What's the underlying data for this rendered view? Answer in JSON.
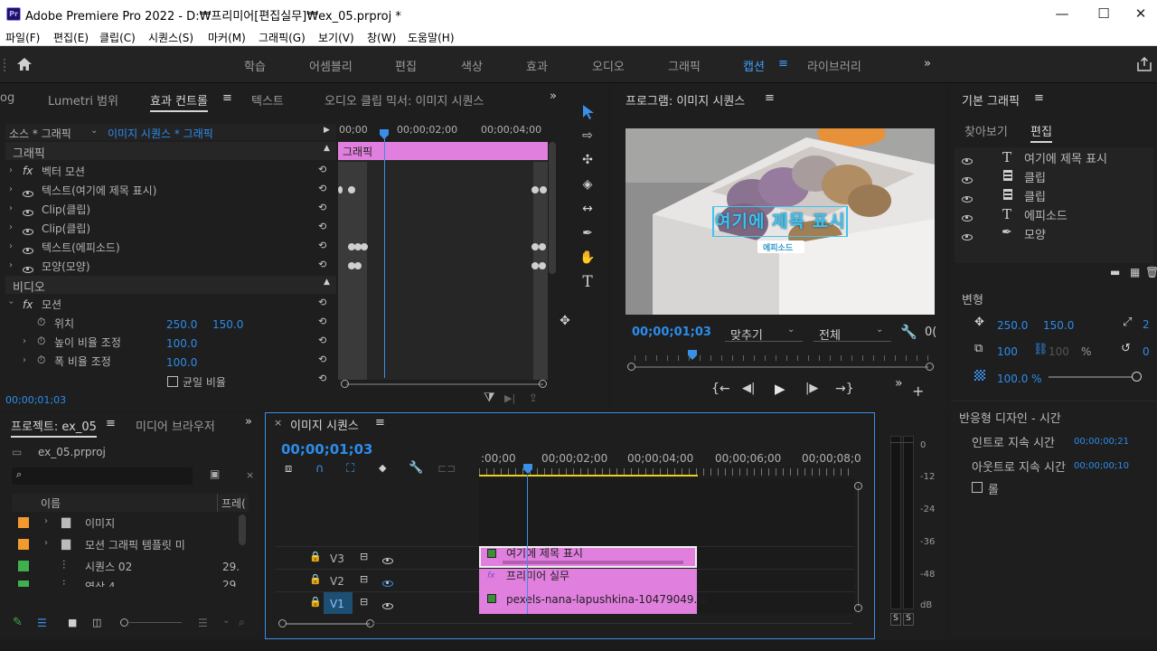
{
  "app": {
    "title": "Adobe Premiere Pro 2022 - D:₩프리미어[편집실무]₩ex_05.prproj *",
    "logo": "Pr",
    "window_controls": [
      "—",
      "☐",
      "✕"
    ]
  },
  "menu": [
    "파일(F)",
    "편집(E)",
    "클립(C)",
    "시퀀스(S)",
    "마커(M)",
    "그래픽(G)",
    "보기(V)",
    "창(W)",
    "도움말(H)"
  ],
  "workspaces": {
    "items": [
      "학습",
      "어셈블리",
      "편집",
      "색상",
      "효과",
      "오디오",
      "그래픽",
      "캡션",
      "라이브러리"
    ],
    "active": "캡션",
    "menu_glyph": "≡",
    "overflow": "»"
  },
  "effect_controls": {
    "tabs": [
      "og",
      "Lumetri 범위",
      "효과 컨트롤",
      "텍스트",
      "오디오 클립 믹서: 이미지 시퀀스"
    ],
    "active_tab": "효과 컨트롤",
    "source_label": "소스 * 그래픽",
    "sequence_label": "이미지 시퀀스 * 그래픽",
    "ruler": [
      "00;00",
      "00;00;02;00",
      "00;00;04;00"
    ],
    "clip_bar_label": "그래픽",
    "section_graphic": "그래픽",
    "section_video": "비디오",
    "graphic_rows": [
      {
        "label": "벡터 모션",
        "fx": true
      },
      {
        "label": "텍스트(여기에 제목 표시)"
      },
      {
        "label": "Clip(클립)"
      },
      {
        "label": "Clip(클립)"
      },
      {
        "label": "텍스트(에피소드)"
      },
      {
        "label": "모양(모양)"
      }
    ],
    "motion_label": "모션",
    "position": {
      "label": "위치",
      "x": "250.0",
      "y": "150.0"
    },
    "scale_h": {
      "label": "높이 비율 조정",
      "value": "100.0"
    },
    "scale_w": {
      "label": "폭 비율 조정",
      "value": "100.0"
    },
    "uniform": "균일 비율",
    "timecode": "00;00;01;03"
  },
  "tools": [
    "selection-tool",
    "track-select-tool",
    "ripple-edit-tool",
    "razor-tool",
    "slip-tool",
    "pen-tool",
    "hand-tool",
    "type-tool"
  ],
  "program": {
    "title": "프로그램: 이미지 시퀀스",
    "overlay_title": "여기에 제목 표시",
    "overlay_badge": "에피소드",
    "timecode": "00;00;01;03",
    "fit": "맞추기",
    "quality": "전체",
    "right_tc": "0("
  },
  "essential_graphics": {
    "title": "기본 그래픽",
    "tabs": [
      "찾아보기",
      "편집"
    ],
    "active_tab": "편집",
    "layers": [
      {
        "icon": "T",
        "label": "여기에 제목 표시"
      },
      {
        "icon": "clip",
        "label": "클립"
      },
      {
        "icon": "clip",
        "label": "클립"
      },
      {
        "icon": "T",
        "label": "에피소드"
      },
      {
        "icon": "pen",
        "label": "모양"
      }
    ],
    "transform_label": "변형",
    "pos_x": "250.0",
    "pos_y": "150.0",
    "anchor": "2",
    "scale": "100",
    "scale2": "100",
    "percent": "%",
    "rotation": "0",
    "opacity": "100.0 %",
    "responsive_title": "반응형 디자인 - 시간",
    "intro_label": "인트로 지속 시간",
    "intro_value": "00;00;00;21",
    "outro_label": "아웃트로 지속 시간",
    "outro_value": "00;00;00;10",
    "roll_label": "롤"
  },
  "project": {
    "tabs": [
      "프로젝트: ex_05",
      "미디어 브라우저"
    ],
    "file": "ex_05.prproj",
    "col_name": "이름",
    "col_frame": "프레(",
    "items": [
      {
        "color": "#f29a2e",
        "type": "folder",
        "label": "이미지",
        "value": ""
      },
      {
        "color": "#f29a2e",
        "type": "folder",
        "label": "모션 그래픽 템플릿 미",
        "value": ""
      },
      {
        "color": "#3fb04c",
        "type": "sequence",
        "label": "시퀀스 02",
        "value": "29."
      },
      {
        "color": "#3fb04c",
        "type": "sequence",
        "label": "영상 4",
        "value": "29."
      }
    ]
  },
  "timeline": {
    "title": "이미지 시퀀스",
    "timecode": "00;00;01;03",
    "ruler": [
      ":00;00",
      "00;00;02;00",
      "00;00;04;00",
      "00;00;06;00",
      "00;00;08;0"
    ],
    "tracks": [
      {
        "name": "V3",
        "clip": "여기에 제목 표시"
      },
      {
        "name": "V2",
        "clip": "프리미어 실무"
      },
      {
        "name": "V1",
        "clip": "pexels-nana-lapushkina-10479049.jp"
      }
    ]
  },
  "audio_meter": {
    "scale": [
      "0",
      "-12",
      "-24",
      "-36",
      "-48",
      "dB"
    ],
    "solo": [
      "S",
      "S"
    ]
  }
}
